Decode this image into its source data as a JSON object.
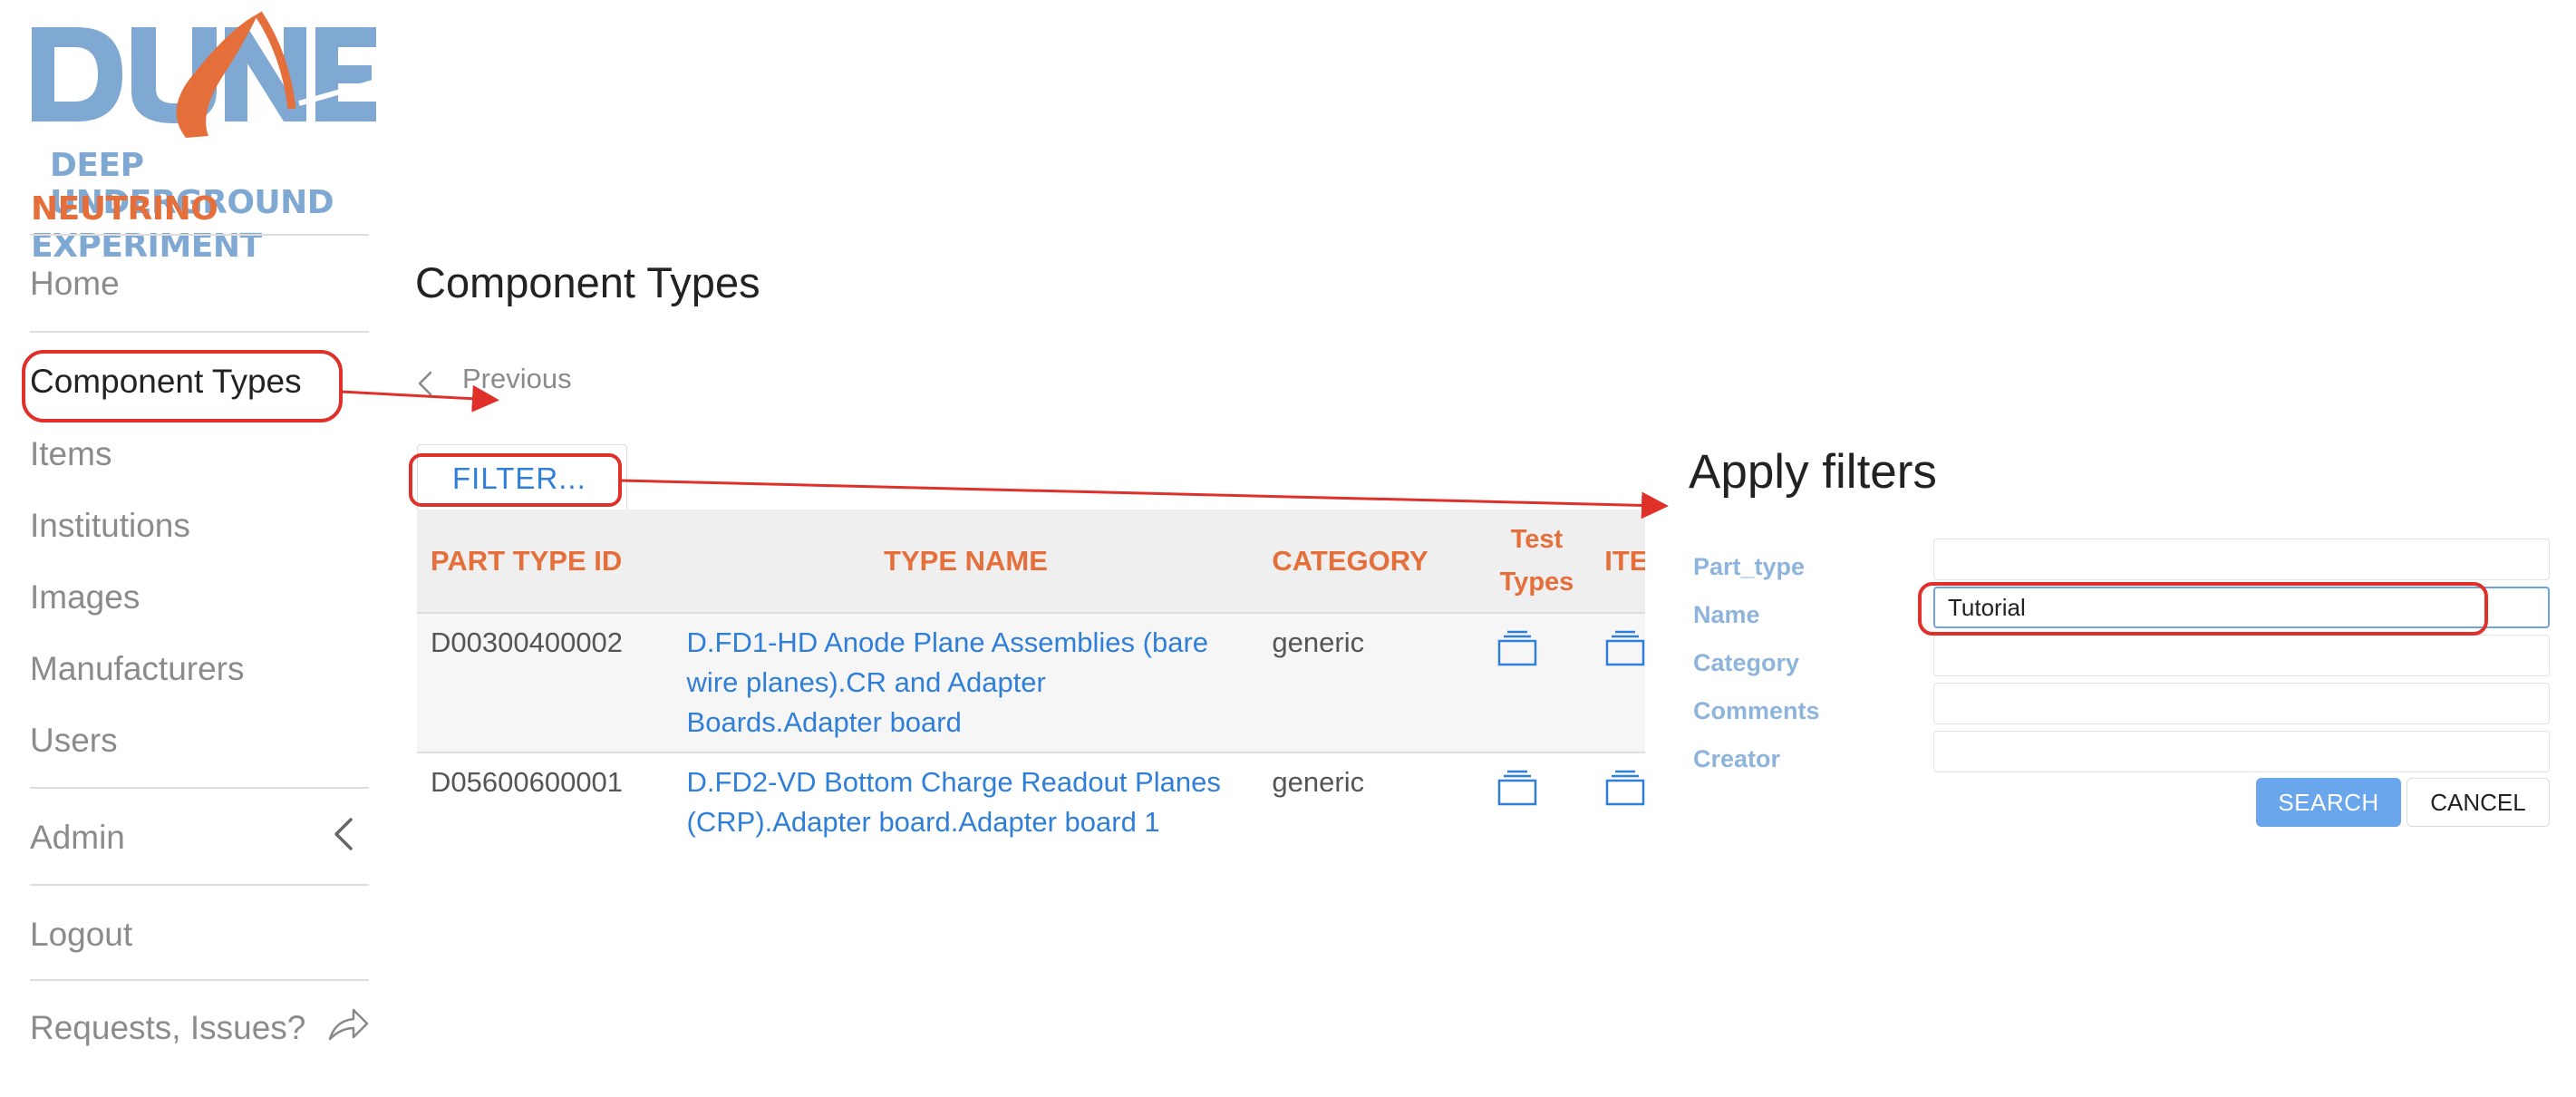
{
  "brand": {
    "logo_mark": "DUNE",
    "line1": "DEEP UNDERGROUND",
    "line2_a": "NEUTRINO",
    "line2_b": "EXPERIMENT"
  },
  "sidebar": {
    "items": [
      {
        "label": "Home"
      },
      {
        "label": "Component Types",
        "active": true
      },
      {
        "label": "Items"
      },
      {
        "label": "Institutions"
      },
      {
        "label": "Images"
      },
      {
        "label": "Manufacturers"
      },
      {
        "label": "Users"
      },
      {
        "label": "Admin"
      },
      {
        "label": "Logout"
      },
      {
        "label": "Requests, Issues?"
      }
    ]
  },
  "main": {
    "title": "Component Types",
    "previous_label": "Previous",
    "filter_label": "FILTER...",
    "table": {
      "headers": [
        "PART TYPE ID",
        "TYPE NAME",
        "CATEGORY",
        "Test",
        "Types",
        "ITEMS"
      ],
      "rows": [
        {
          "id": "D00300400002",
          "name": "D.FD1-HD Anode Plane Assemblies (bare wire planes).CR and Adapter Boards.Adapter board",
          "category": "generic"
        },
        {
          "id": "D05600600001",
          "name": "D.FD2-VD Bottom Charge Readout Planes (CRP).Adapter board.Adapter board 1",
          "category": "generic"
        }
      ]
    }
  },
  "filters": {
    "title": "Apply filters",
    "fields": [
      {
        "label": "Part_type",
        "value": ""
      },
      {
        "label": "Name",
        "value": "Tutorial"
      },
      {
        "label": "Category",
        "value": ""
      },
      {
        "label": "Comments",
        "value": ""
      },
      {
        "label": "Creator",
        "value": ""
      }
    ],
    "search_label": "SEARCH",
    "cancel_label": "CANCEL"
  },
  "colors": {
    "accent_blue": "#2f7fd9",
    "brand_orange": "#e56f3a",
    "annotation_red": "#e0302a",
    "search_button": "#6aa6eb"
  },
  "icons": {
    "prev": "chevron-left-icon",
    "admin": "chevron-left-icon",
    "external": "share-arrow-icon",
    "test_types": "tray-icon"
  }
}
